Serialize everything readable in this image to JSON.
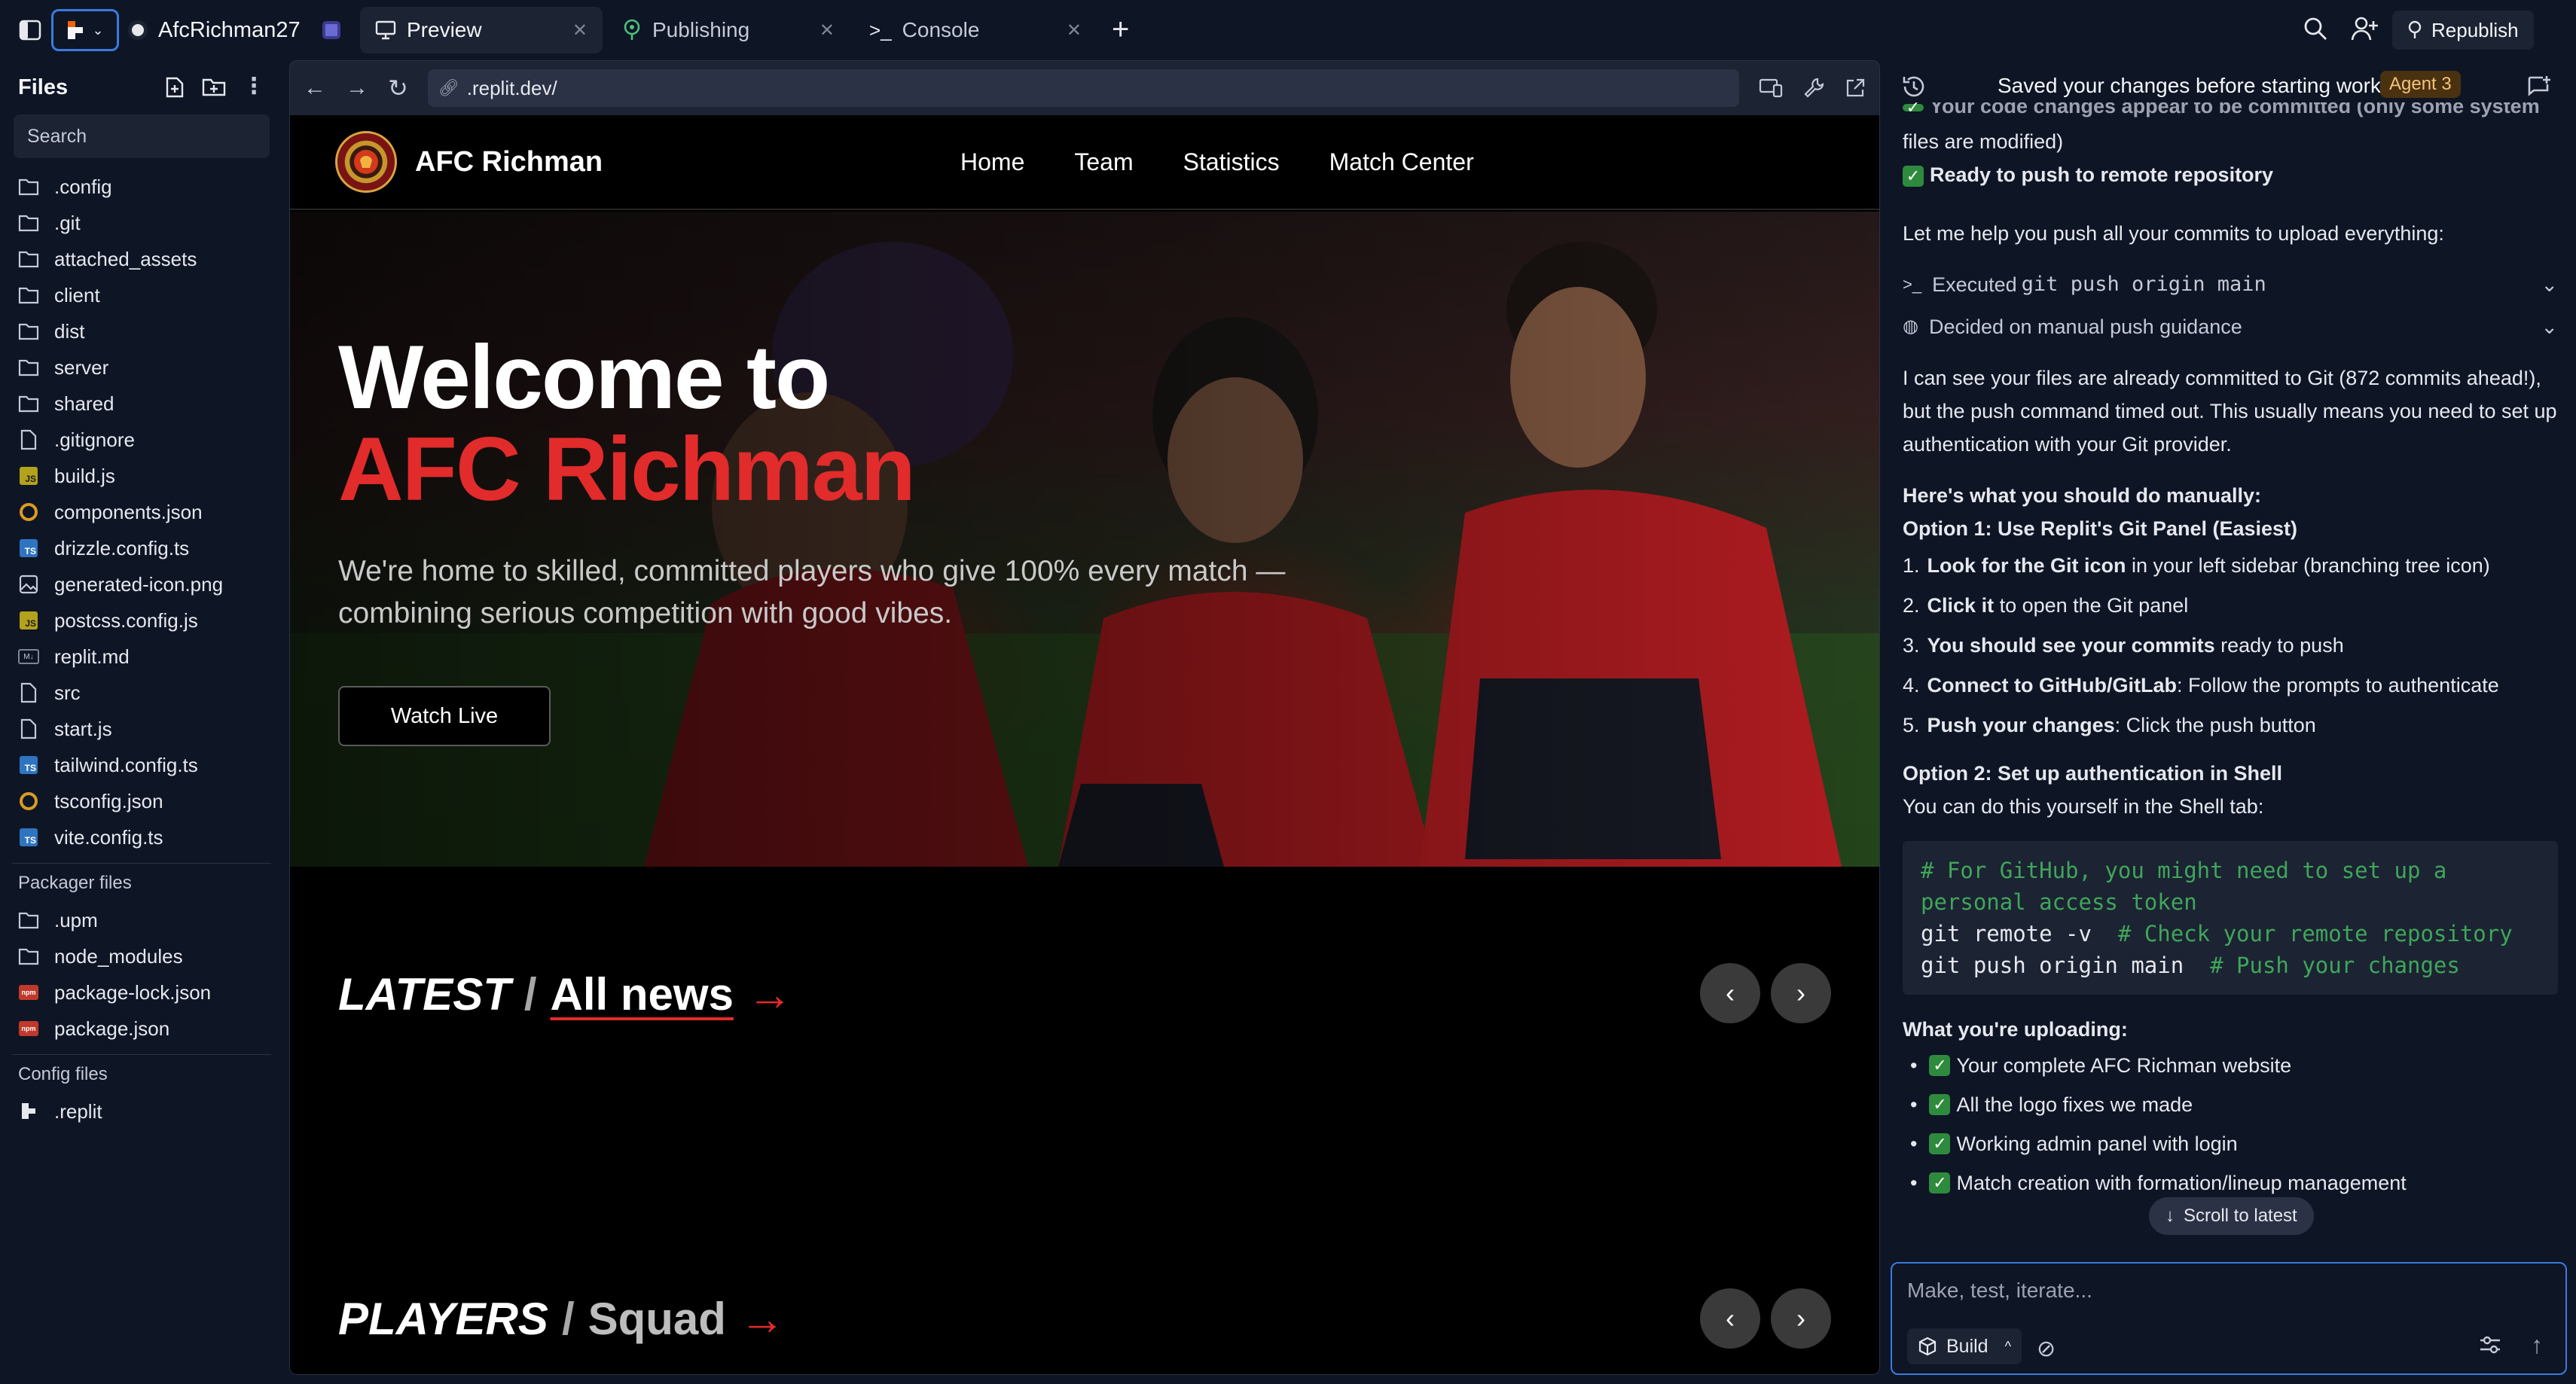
{
  "topbar": {
    "project_name": "AfcRichman27",
    "tabs": [
      {
        "label": "Preview"
      },
      {
        "label": "Publishing"
      },
      {
        "label": "Console"
      }
    ],
    "republish_label": "Republish"
  },
  "sidebar": {
    "title": "Files",
    "search_placeholder": "Search",
    "files": [
      {
        "name": ".config",
        "icon": "folder"
      },
      {
        "name": ".git",
        "icon": "folder"
      },
      {
        "name": "attached_assets",
        "icon": "folder"
      },
      {
        "name": "client",
        "icon": "folder"
      },
      {
        "name": "dist",
        "icon": "folder"
      },
      {
        "name": "server",
        "icon": "folder"
      },
      {
        "name": "shared",
        "icon": "folder"
      },
      {
        "name": ".gitignore",
        "icon": "file"
      },
      {
        "name": "build.js",
        "icon": "js"
      },
      {
        "name": "components.json",
        "icon": "json-circle"
      },
      {
        "name": "drizzle.config.ts",
        "icon": "ts"
      },
      {
        "name": "generated-icon.png",
        "icon": "image"
      },
      {
        "name": "postcss.config.js",
        "icon": "js"
      },
      {
        "name": "replit.md",
        "icon": "md"
      },
      {
        "name": "src",
        "icon": "file"
      },
      {
        "name": "start.js",
        "icon": "file"
      },
      {
        "name": "tailwind.config.ts",
        "icon": "ts"
      },
      {
        "name": "tsconfig.json",
        "icon": "json-circle"
      },
      {
        "name": "vite.config.ts",
        "icon": "ts"
      }
    ],
    "packager_title": "Packager files",
    "packager_files": [
      {
        "name": ".upm",
        "icon": "folder"
      },
      {
        "name": "node_modules",
        "icon": "folder"
      },
      {
        "name": "package-lock.json",
        "icon": "npm"
      },
      {
        "name": "package.json",
        "icon": "npm"
      }
    ],
    "config_title": "Config files",
    "config_files": [
      {
        "name": ".replit",
        "icon": "replit"
      }
    ]
  },
  "preview": {
    "url": ".replit.dev/",
    "site": {
      "brand": "AFC Richman",
      "nav": [
        "Home",
        "Team",
        "Statistics",
        "Match Center"
      ],
      "hero_line1": "Welcome to",
      "hero_line2": "AFC Richman",
      "hero_sub": "We're home to skilled, committed players who give 100% every match — combining serious competition with good vibes.",
      "watch_live": "Watch Live",
      "latest_title": "LATEST",
      "latest_link": "All news",
      "players_title": "PLAYERS",
      "players_link": "Squad",
      "arrow": "→",
      "slash": "/"
    }
  },
  "agent": {
    "header_title": "Saved your changes before starting work",
    "badge": "Agent 3",
    "cut_line": "Your code changes appear to be committed (only some system",
    "line_files_modified": "files are modified)",
    "ready_push": "Ready to push to remote repository",
    "intro": "Let me help you push all your commits to upload everything:",
    "action1_prefix": "Executed ",
    "action1_code": "git push origin main",
    "action2": "Decided on manual push guidance",
    "para1": "I can see your files are already committed to Git (872 commits ahead!), but the push command timed out. This usually means you need to set up authentication with your Git provider.",
    "manual_heading": "Here's what you should do manually:",
    "option1_heading": "Option 1: Use Replit's Git Panel (Easiest)",
    "steps": [
      {
        "num": "1.",
        "bold": "Look for the Git icon",
        "rest": " in your left sidebar (branching tree icon)"
      },
      {
        "num": "2.",
        "bold": "Click it",
        "rest": " to open the Git panel"
      },
      {
        "num": "3.",
        "bold": "You should see your commits",
        "rest": " ready to push"
      },
      {
        "num": "4.",
        "bold": "Connect to GitHub/GitLab",
        "rest": ": Follow the prompts to authenticate"
      },
      {
        "num": "5.",
        "bold": "Push your changes",
        "rest": ": Click the push button"
      }
    ],
    "option2_heading": "Option 2: Set up authentication in Shell",
    "option2_text": "You can do this yourself in the Shell tab:",
    "code_comment1": "# For GitHub, you might need to set up a",
    "code_comment1b": "personal access token",
    "code_cmd2": "git remote -v",
    "code_comment2": "# Check your remote repository",
    "code_cmd3": "git push origin main",
    "code_comment3": "# Push your changes",
    "uploading_heading": "What you're uploading:",
    "uploading_items": [
      "Your complete AFC Richman website",
      "All the logo fixes we made",
      "Working admin panel with login",
      "Match creation with formation/lineup management"
    ],
    "scroll_latest": "Scroll to latest",
    "composer_placeholder": "Make, test, iterate...",
    "build_label": "Build"
  },
  "colors": {
    "accent_red": "#e22b2b",
    "editor_bg": "#0e1525",
    "panel_bg": "#1c2333",
    "focus_blue": "#3a7bdc",
    "agent_badge": "#4a3210"
  }
}
